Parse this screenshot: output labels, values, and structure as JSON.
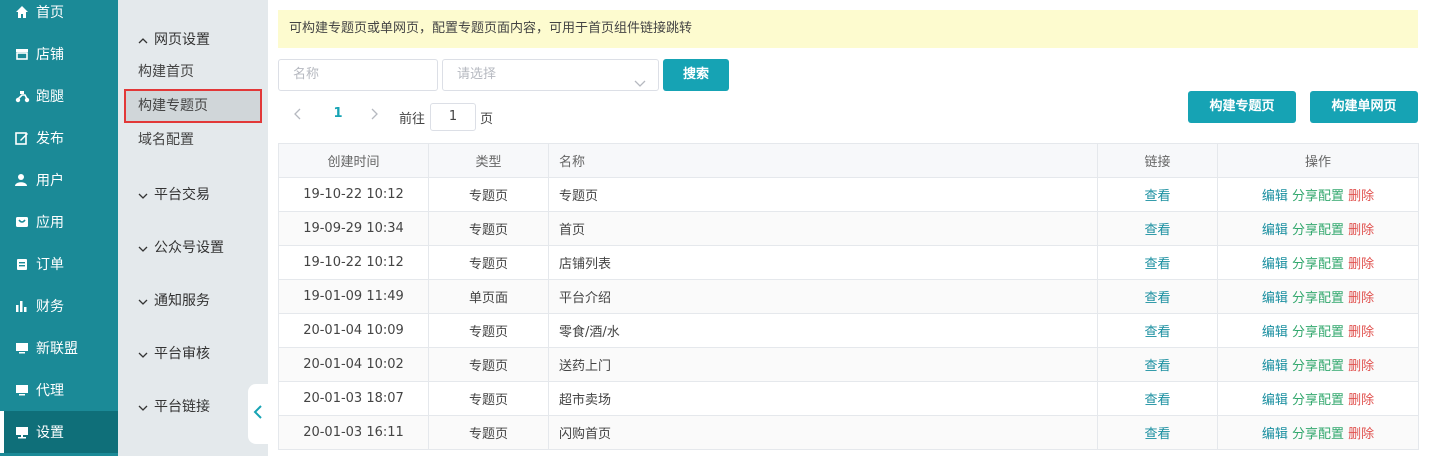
{
  "mainnav": [
    {
      "label": "首页",
      "icon": "home-icon"
    },
    {
      "label": "店铺",
      "icon": "store-icon"
    },
    {
      "label": "跑腿",
      "icon": "scooter-icon"
    },
    {
      "label": "发布",
      "icon": "edit-icon"
    },
    {
      "label": "用户",
      "icon": "user-icon"
    },
    {
      "label": "应用",
      "icon": "app-icon"
    },
    {
      "label": "订单",
      "icon": "clipboard-icon"
    },
    {
      "label": "财务",
      "icon": "bar-chart-icon"
    },
    {
      "label": "新联盟",
      "icon": "monitor-icon"
    },
    {
      "label": "代理",
      "icon": "monitor-icon"
    },
    {
      "label": "设置",
      "icon": "desktop-icon"
    }
  ],
  "subnav": {
    "groups": [
      "网页设置",
      "平台交易",
      "公众号设置",
      "通知服务",
      "平台审核",
      "平台链接"
    ],
    "links": [
      "构建首页",
      "构建专题页",
      "域名配置"
    ]
  },
  "notice": "可构建专题页或单网页，配置专题页面内容，可用于首页组件链接跳转",
  "search": {
    "name_placeholder": "名称",
    "select_placeholder": "请选择",
    "button": "搜索"
  },
  "pager": {
    "current": "1",
    "goto_label": "前往",
    "goto_value": "1",
    "unit": "页"
  },
  "actions": {
    "build_topic": "构建专题页",
    "build_single": "构建单网页"
  },
  "table": {
    "headers": [
      "创建时间",
      "类型",
      "名称",
      "链接",
      "操作"
    ],
    "view_label": "查看",
    "op_edit": "编辑",
    "op_share": "分享配置",
    "op_delete": "删除",
    "rows": [
      {
        "time": "19-10-22 10:12",
        "type": "专题页",
        "name": "专题页"
      },
      {
        "time": "19-09-29 10:34",
        "type": "专题页",
        "name": "首页"
      },
      {
        "time": "19-10-22 10:12",
        "type": "专题页",
        "name": "店铺列表"
      },
      {
        "time": "19-01-09 11:49",
        "type": "单页面",
        "name": "平台介绍"
      },
      {
        "time": "20-01-04 10:09",
        "type": "专题页",
        "name": "零食/酒/水"
      },
      {
        "time": "20-01-04 10:02",
        "type": "专题页",
        "name": "送药上门"
      },
      {
        "time": "20-01-03 18:07",
        "type": "专题页",
        "name": "超市卖场"
      },
      {
        "time": "20-01-03 16:11",
        "type": "专题页",
        "name": "闪购首页"
      }
    ]
  }
}
